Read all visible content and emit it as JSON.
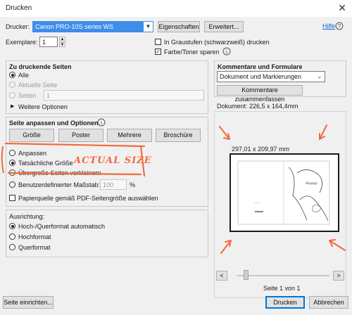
{
  "window": {
    "title": "Drucken",
    "close_glyph": "✕"
  },
  "printer": {
    "label": "Drucker:",
    "selected": "Canon PRO-10S series WS",
    "properties_button": "Eigenschaften",
    "advanced_button": "Erweitert...",
    "help_link": "Hilfe"
  },
  "copies": {
    "label": "Exemplare:",
    "value": "1",
    "grayscale_label": "In Graustufen (schwarzweiß) drucken",
    "grayscale_checked": false,
    "ink_save_label": "Farbe/Toner sparen",
    "ink_save_checked": true
  },
  "pages": {
    "heading": "Zu druckende Seiten",
    "options": [
      {
        "label": "Alle",
        "selected": true,
        "disabled": false
      },
      {
        "label": "Aktuelle Seite",
        "selected": false,
        "disabled": true
      },
      {
        "label": "Seiten",
        "selected": false,
        "disabled": true
      }
    ],
    "range_value": "1",
    "more_options": "Weitere Optionen"
  },
  "sizing": {
    "heading": "Seite anpassen und Optionen",
    "buttons": [
      "Größe",
      "Poster",
      "Mehrere",
      "Broschüre"
    ],
    "options": [
      {
        "label": "Anpassen",
        "selected": false
      },
      {
        "label": "Tatsächliche Größe",
        "selected": true
      },
      {
        "label": "Übergroße Seiten verkleinern",
        "selected": false
      },
      {
        "label": "Benutzerdefinierter Maßstab:",
        "selected": false
      }
    ],
    "scale_value": "100",
    "scale_unit": "%",
    "paper_source_label": "Papierquelle gemäß PDF-Seitengröße auswählen",
    "paper_source_checked": false
  },
  "orientation": {
    "heading": "Ausrichtung:",
    "options": [
      {
        "label": "Hoch-/Querformat automatisch",
        "selected": true
      },
      {
        "label": "Hochformat",
        "selected": false
      },
      {
        "label": "Querformat",
        "selected": false
      }
    ]
  },
  "comments": {
    "heading": "Kommentare und Formulare",
    "selected": "Dokument und Markierungen",
    "summarize_button": "Kommentare zusammenfassen"
  },
  "preview": {
    "document_size": "Dokument: 226,5 x 164,4mm",
    "paper_size": "297,01 x 209,97 mm",
    "page_indicator": "Seite 1 von 1",
    "prev_glyph": "<",
    "next_glyph": ">",
    "zoom_fraction": 0.1
  },
  "annotation": {
    "text": "ACTUAL SIZE",
    "color": "#f26a3d"
  },
  "footer": {
    "setup_button": "Seite einrichten...",
    "print_button": "Drucken",
    "cancel_button": "Abbrechen"
  }
}
